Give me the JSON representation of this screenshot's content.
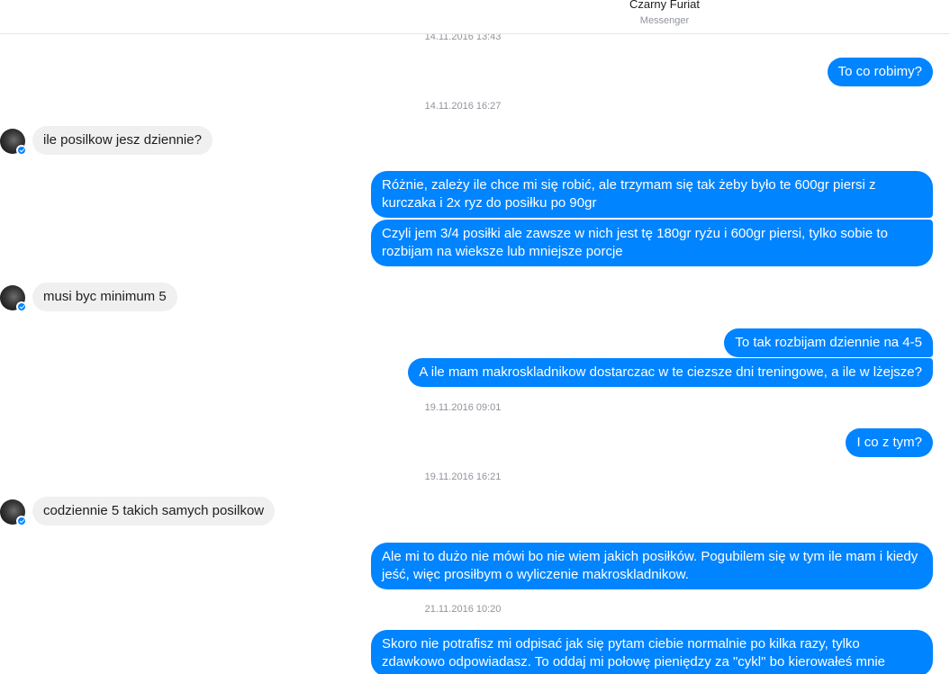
{
  "header": {
    "contact_name": "Czarny Furiat",
    "app_label": "Messenger"
  },
  "timestamps": [
    "14.11.2016 13:43",
    "14.11.2016 16:27",
    "19.11.2016 09:01",
    "19.11.2016 16:21",
    "21.11.2016 10:20"
  ],
  "messages": [
    {
      "from": "me",
      "text": "To co robimy?"
    },
    {
      "from": "contact",
      "text": "ile posilkow jesz dziennie?"
    },
    {
      "from": "me",
      "text": "Różnie, zależy ile chce mi się robić, ale trzymam się tak żeby było te 600gr piersi z kurczaka i 2x ryz do posiłku po 90gr"
    },
    {
      "from": "me",
      "text": "Czyli jem 3/4 posiłki ale zawsze w nich jest tę 180gr ryżu i 600gr piersi, tylko sobie to rozbijam na wieksze lub mniejsze porcje"
    },
    {
      "from": "contact",
      "text": "musi byc minimum 5"
    },
    {
      "from": "me",
      "text": "To tak rozbijam dziennie na 4-5"
    },
    {
      "from": "me",
      "text": "A ile mam makroskladnikow dostarczac w te ciezsze dni treningowe, a ile w lżejsze?"
    },
    {
      "from": "me",
      "text": "I co z tym?"
    },
    {
      "from": "contact",
      "text": "codziennie 5 takich samych posilkow"
    },
    {
      "from": "me",
      "text": "Ale mi to dużo nie mówi bo nie wiem jakich posiłków. Pogubilem się w tym ile mam i kiedy jeść, więc prosiłbym o wyliczenie makroskladnikow."
    },
    {
      "from": "me",
      "text": "Skoro nie potrafisz mi odpisać jak się pytam ciebie normalnie po kilka razy, tylko zdawkowo odpowiadasz. To oddaj mi połowę pieniędzy za \"cykl\" bo kierowałeś mnie"
    }
  ]
}
